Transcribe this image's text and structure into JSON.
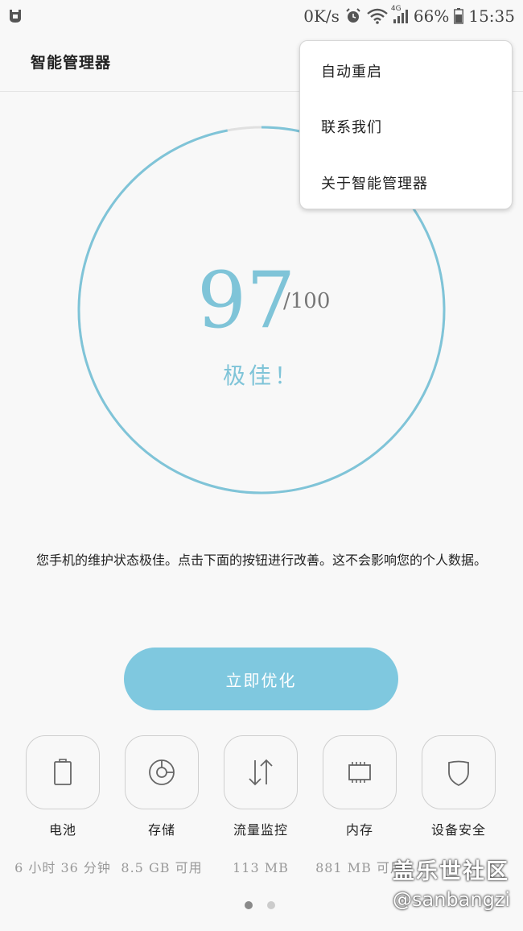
{
  "status_bar": {
    "speed": "0K/s",
    "network": "4G",
    "battery": "66%",
    "time": "15:35"
  },
  "app_bar": {
    "title": "智能管理器"
  },
  "menu": {
    "items": [
      {
        "label": "自动重启"
      },
      {
        "label": "联系我们"
      },
      {
        "label": "关于智能管理器"
      }
    ]
  },
  "score": {
    "value": "97",
    "max": "/100",
    "status": "极佳！",
    "fraction": 0.97,
    "accent_color": "#7fc4d8"
  },
  "description": "您手机的维护状态极佳。点击下面的按钮进行改善。这不会影响您的个人数据。",
  "optimize_button": {
    "label": "立即优化",
    "color": "#7fc8df"
  },
  "tools": [
    {
      "label": "电池",
      "value": "6 小时 36 分钟",
      "icon": "battery-icon"
    },
    {
      "label": "存储",
      "value": "8.5 GB 可用",
      "icon": "storage-icon"
    },
    {
      "label": "流量监控",
      "value": "113 MB",
      "icon": "data-transfer-icon"
    },
    {
      "label": "内存",
      "value": "881 MB 可用",
      "icon": "memory-chip-icon"
    },
    {
      "label": "设备安全",
      "value": "",
      "icon": "shield-icon"
    }
  ],
  "pagination": {
    "current": 1,
    "total": 2
  },
  "watermark": {
    "line1": "盖乐世社区",
    "line2": "@sanbangzi"
  }
}
